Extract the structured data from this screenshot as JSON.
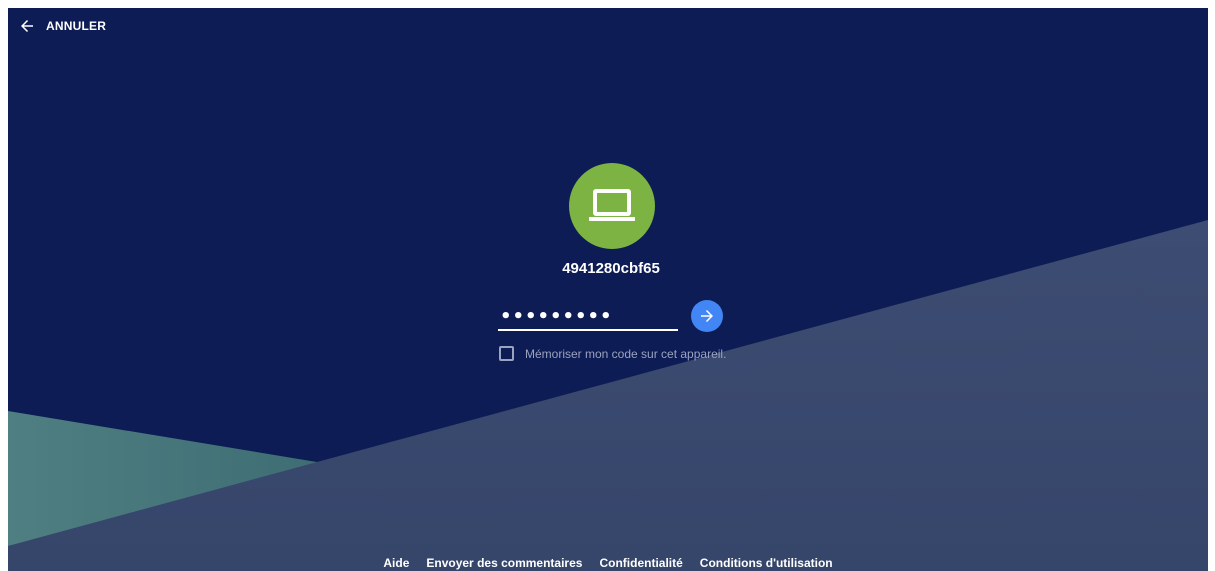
{
  "topbar": {
    "back_icon": "arrow-left-icon",
    "cancel_label": "ANNULER"
  },
  "avatar": {
    "icon": "laptop-icon",
    "color": "#7cb342"
  },
  "device": {
    "name": "4941280cbf65"
  },
  "pin": {
    "value": "•••••••••",
    "input_type": "password"
  },
  "submit": {
    "icon": "arrow-right-icon",
    "color": "#4285f4"
  },
  "remember": {
    "label": "Mémoriser mon code sur cet appareil.",
    "checked": false
  },
  "footer": {
    "links": [
      {
        "label": "Aide"
      },
      {
        "label": "Envoyer des commentaires"
      },
      {
        "label": "Confidentialité"
      },
      {
        "label": "Conditions d'utilisation"
      }
    ]
  },
  "colors": {
    "background": "#0e1c55",
    "lower_panel": "#3b4a6e",
    "teal_panel": "#4f7f82"
  }
}
